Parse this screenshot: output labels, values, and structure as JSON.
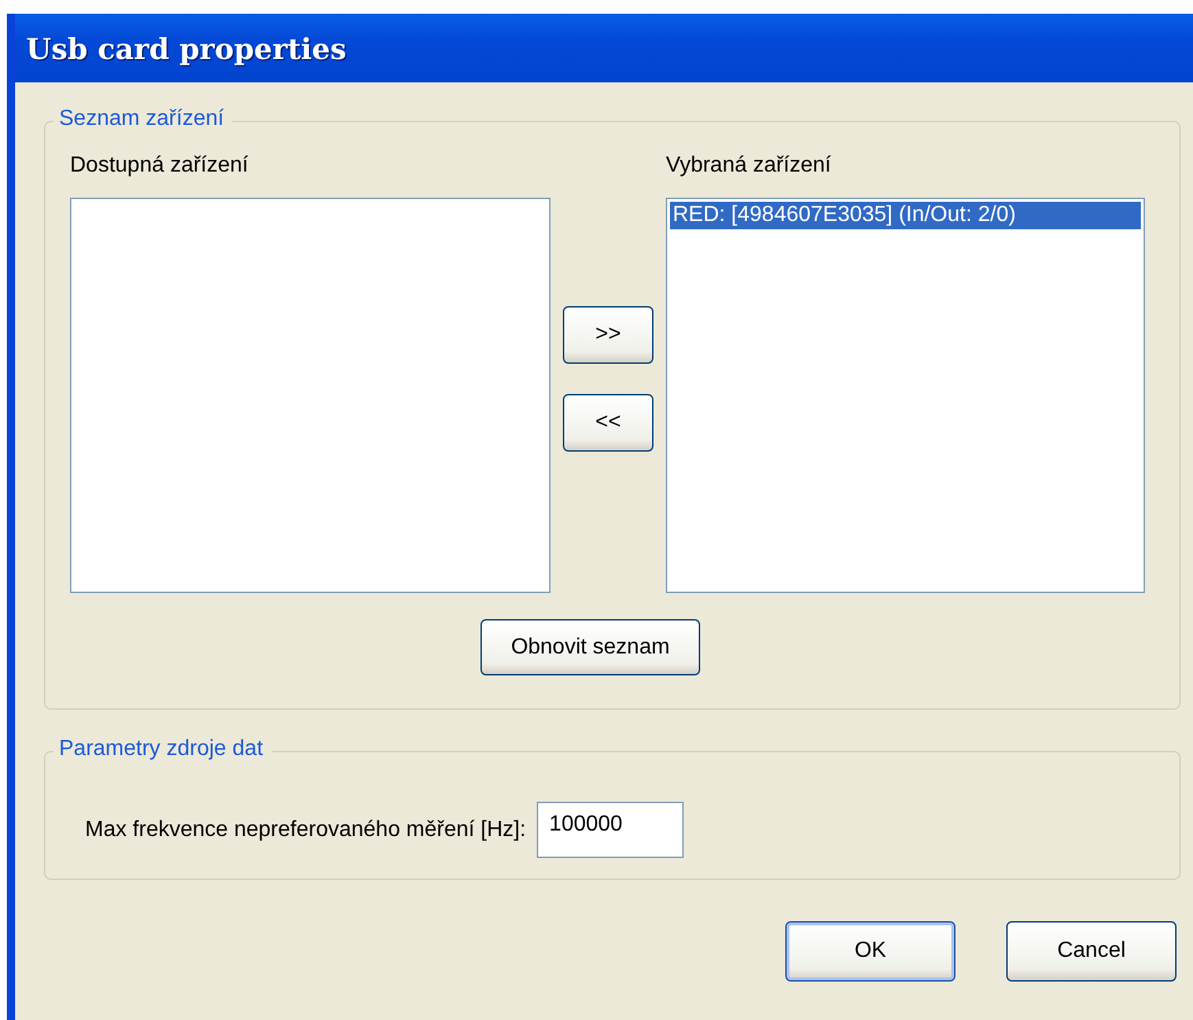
{
  "window": {
    "title": "Usb card properties"
  },
  "device_list": {
    "legend": "Seznam zařízení",
    "available": {
      "label": "Dostupná zařízení"
    },
    "move_buttons": [
      ">>",
      "<<"
    ],
    "chosen": {
      "label": "Vybraná zařízení",
      "items": [
        {
          "text": "RED: [4984607E3035] (In/Out: 2/0)",
          "selected": true
        }
      ]
    },
    "refresh_button": "Obnovit seznam"
  },
  "data_source": {
    "legend": "Parametry zdroje dat",
    "field": {
      "label": "Max frekvence nepreferovaného měření [Hz]:",
      "value": "100000"
    }
  },
  "buttons": [
    {
      "label": "OK",
      "default": true
    },
    {
      "label": "Cancel",
      "default": false
    }
  ]
}
